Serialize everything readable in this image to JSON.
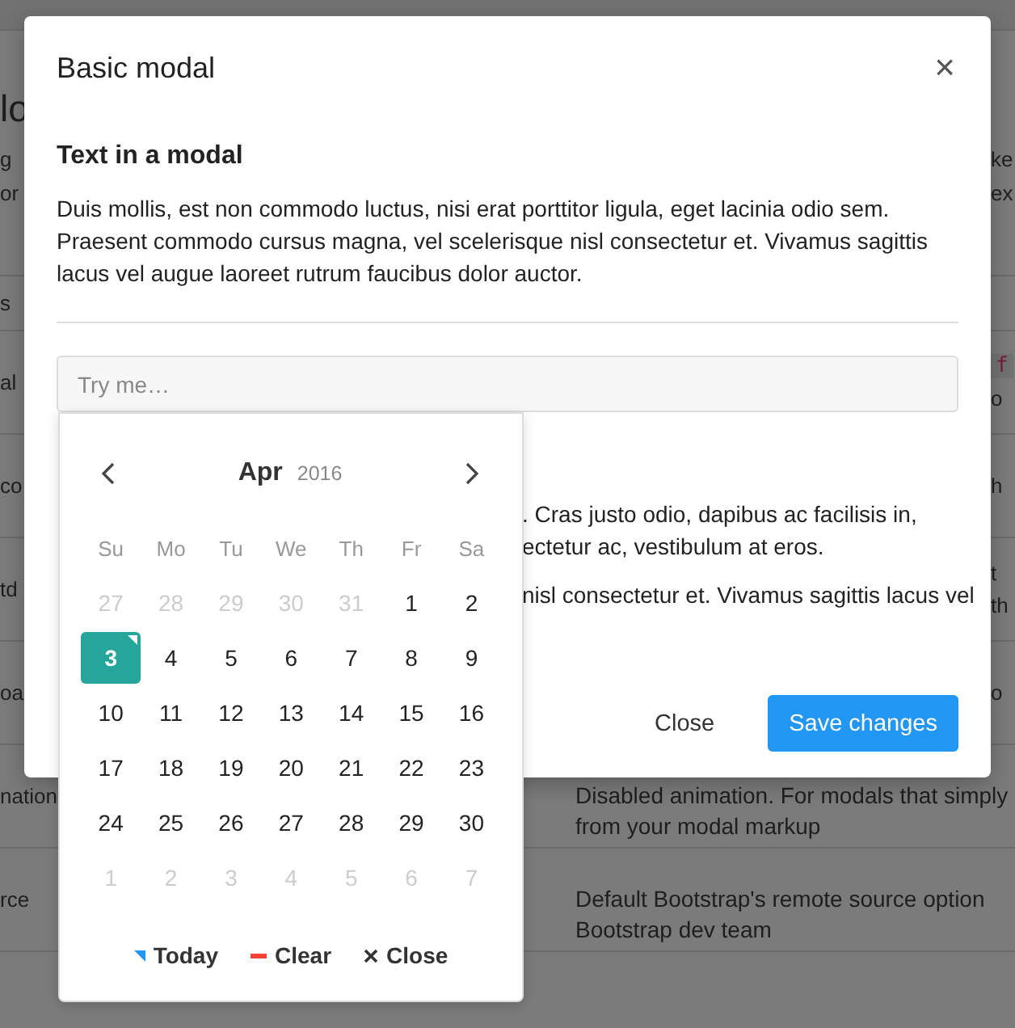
{
  "background_page": {
    "heading": "lo",
    "intro_left": [
      "g",
      "or"
    ],
    "intro_right": [
      "ke",
      "ex"
    ],
    "rows": [
      {
        "column_1": "s",
        "kind": "header"
      },
      {
        "column_1": "al",
        "column_3": [
          {
            "text": "f",
            "kind": "code"
          },
          {
            "text": "o",
            "kind": "text"
          }
        ],
        "kind": "body"
      },
      {
        "column_1": "co",
        "column_3": [
          {
            "text": "h",
            "kind": "text"
          }
        ],
        "kind": "body"
      },
      {
        "column_1": "td",
        "column_3": [
          {
            "text": "t",
            "kind": "text"
          },
          {
            "text": "th",
            "kind": "text"
          }
        ],
        "kind": "body"
      },
      {
        "column_1": "oa",
        "column_3": [
          {
            "text": "o",
            "kind": "text"
          }
        ],
        "kind": "body"
      },
      {
        "column_1": "nation",
        "column_2": [
          "Disabled animation. For modals that simply",
          "from your modal markup"
        ],
        "kind": "body"
      },
      {
        "column_1": "rce",
        "column_2": [
          "Default Bootstrap's remote source option",
          "Bootstrap dev team"
        ],
        "kind": "body"
      },
      {
        "kind": "footer"
      }
    ]
  },
  "modal": {
    "title": "Basic modal",
    "close": "×",
    "heading": "Text in a modal",
    "paragraph": "Duis mollis, est non commodo luctus, nisi erat porttitor ligula, eget lacinia odio sem. Praesent commodo cursus magna, vel scelerisque nisl consectetur et. Vivamus sagittis lacus vel augue laoreet rutrum faucibus dolor auctor.",
    "input": {
      "placeholder": "Try me…"
    },
    "hidden_paragraphs": [
      [
        ". Cras justo odio, dapibus ac facilisis in,",
        "ectetur ac, vestibulum at eros."
      ],
      [
        "nisl consectetur et. Vivamus sagittis lacus vel"
      ]
    ],
    "buttons": [
      {
        "label": "Close",
        "kind": "secondary"
      },
      {
        "label": "Save changes",
        "kind": "primary"
      }
    ]
  },
  "datepicker": {
    "month": "Apr",
    "year": "2016",
    "weekdays": [
      "Su",
      "Mo",
      "Tu",
      "We",
      "Th",
      "Fr",
      "Sa"
    ],
    "weeks": [
      [
        {
          "label": "27",
          "muted": true,
          "selected": false,
          "today": false
        },
        {
          "label": "28",
          "muted": true,
          "selected": false,
          "today": false
        },
        {
          "label": "29",
          "muted": true,
          "selected": false,
          "today": false
        },
        {
          "label": "30",
          "muted": true,
          "selected": false,
          "today": false
        },
        {
          "label": "31",
          "muted": true,
          "selected": false,
          "today": false
        },
        {
          "label": "1",
          "muted": false,
          "selected": false,
          "today": false
        },
        {
          "label": "2",
          "muted": false,
          "selected": false,
          "today": false
        }
      ],
      [
        {
          "label": "3",
          "muted": false,
          "selected": true,
          "today": true
        },
        {
          "label": "4",
          "muted": false,
          "selected": false,
          "today": false
        },
        {
          "label": "5",
          "muted": false,
          "selected": false,
          "today": false
        },
        {
          "label": "6",
          "muted": false,
          "selected": false,
          "today": false
        },
        {
          "label": "7",
          "muted": false,
          "selected": false,
          "today": false
        },
        {
          "label": "8",
          "muted": false,
          "selected": false,
          "today": false
        },
        {
          "label": "9",
          "muted": false,
          "selected": false,
          "today": false
        }
      ],
      [
        {
          "label": "10",
          "muted": false,
          "selected": false,
          "today": false
        },
        {
          "label": "11",
          "muted": false,
          "selected": false,
          "today": false
        },
        {
          "label": "12",
          "muted": false,
          "selected": false,
          "today": false
        },
        {
          "label": "13",
          "muted": false,
          "selected": false,
          "today": false
        },
        {
          "label": "14",
          "muted": false,
          "selected": false,
          "today": false
        },
        {
          "label": "15",
          "muted": false,
          "selected": false,
          "today": false
        },
        {
          "label": "16",
          "muted": false,
          "selected": false,
          "today": false
        }
      ],
      [
        {
          "label": "17",
          "muted": false,
          "selected": false,
          "today": false
        },
        {
          "label": "18",
          "muted": false,
          "selected": false,
          "today": false
        },
        {
          "label": "19",
          "muted": false,
          "selected": false,
          "today": false
        },
        {
          "label": "20",
          "muted": false,
          "selected": false,
          "today": false
        },
        {
          "label": "21",
          "muted": false,
          "selected": false,
          "today": false
        },
        {
          "label": "22",
          "muted": false,
          "selected": false,
          "today": false
        },
        {
          "label": "23",
          "muted": false,
          "selected": false,
          "today": false
        }
      ],
      [
        {
          "label": "24",
          "muted": false,
          "selected": false,
          "today": false
        },
        {
          "label": "25",
          "muted": false,
          "selected": false,
          "today": false
        },
        {
          "label": "26",
          "muted": false,
          "selected": false,
          "today": false
        },
        {
          "label": "27",
          "muted": false,
          "selected": false,
          "today": false
        },
        {
          "label": "28",
          "muted": false,
          "selected": false,
          "today": false
        },
        {
          "label": "29",
          "muted": false,
          "selected": false,
          "today": false
        },
        {
          "label": "30",
          "muted": false,
          "selected": false,
          "today": false
        }
      ],
      [
        {
          "label": "1",
          "muted": true,
          "selected": false,
          "today": false
        },
        {
          "label": "2",
          "muted": true,
          "selected": false,
          "today": false
        },
        {
          "label": "3",
          "muted": true,
          "selected": false,
          "today": false
        },
        {
          "label": "4",
          "muted": true,
          "selected": false,
          "today": false
        },
        {
          "label": "5",
          "muted": true,
          "selected": false,
          "today": false
        },
        {
          "label": "6",
          "muted": true,
          "selected": false,
          "today": false
        },
        {
          "label": "7",
          "muted": true,
          "selected": false,
          "today": false
        }
      ]
    ],
    "actions": [
      {
        "label": "Today",
        "kind": "today"
      },
      {
        "label": "Clear",
        "kind": "clear"
      },
      {
        "label": "Close",
        "kind": "close"
      }
    ]
  }
}
